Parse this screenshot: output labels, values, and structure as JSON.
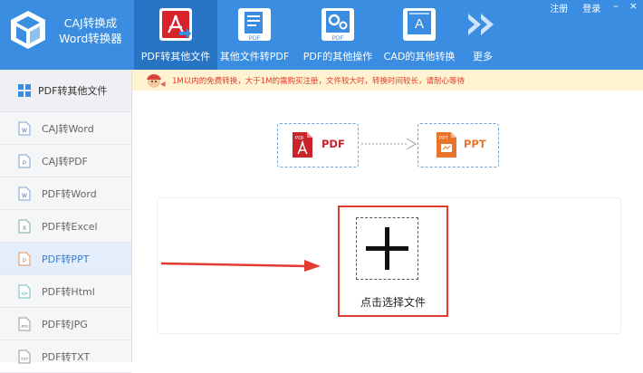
{
  "app": {
    "title_line1": "CAJ转换成",
    "title_line2": "Word转换器",
    "logo_icon": "cube-logo-icon"
  },
  "toolbar": [
    {
      "label": "PDF转其他文件",
      "icon": "pdf-acrobat-icon",
      "active": true
    },
    {
      "label": "其他文件转PDF",
      "icon": "file-to-pdf-icon",
      "active": false
    },
    {
      "label": "PDF的其他操作",
      "icon": "pdf-gear-icon",
      "active": false
    },
    {
      "label": "CAD的其他转换",
      "icon": "cad-icon",
      "active": false
    },
    {
      "label": "更多",
      "icon": "double-chevron-icon",
      "active": false
    }
  ],
  "top_links": {
    "register": "注册",
    "login": "登录"
  },
  "sidebar": {
    "header": "PDF转其他文件",
    "items": [
      {
        "label": "CAJ转Word",
        "icon": "caj-word-icon"
      },
      {
        "label": "CAJ转PDF",
        "icon": "caj-pdf-icon"
      },
      {
        "label": "PDF转Word",
        "icon": "word-file-icon"
      },
      {
        "label": "PDF转Excel",
        "icon": "excel-file-icon"
      },
      {
        "label": "PDF转PPT",
        "icon": "ppt-file-icon",
        "selected": true
      },
      {
        "label": "PDF转Html",
        "icon": "html-file-icon"
      },
      {
        "label": "PDF转JPG",
        "icon": "jpg-file-icon"
      },
      {
        "label": "PDF转TXT",
        "icon": "txt-file-icon"
      }
    ]
  },
  "notice": {
    "text": "1M以内的免费转换，大于1M的需购买注册，文件较大时，转换时间较长，请耐心等待"
  },
  "conversion": {
    "from": {
      "label": "PDF",
      "icon": "pdf-file-icon",
      "icon_text": "PDF"
    },
    "to": {
      "label": "PPT",
      "icon": "ppt-file-icon",
      "icon_text": "PPT"
    }
  },
  "drop": {
    "label": "点击选择文件"
  },
  "colors": {
    "header": "#3a8de0",
    "active_tab": "#2774c4",
    "highlight": "#e23b30",
    "notice_bg": "#fff3d2",
    "selected_item": "#e4eefb"
  }
}
